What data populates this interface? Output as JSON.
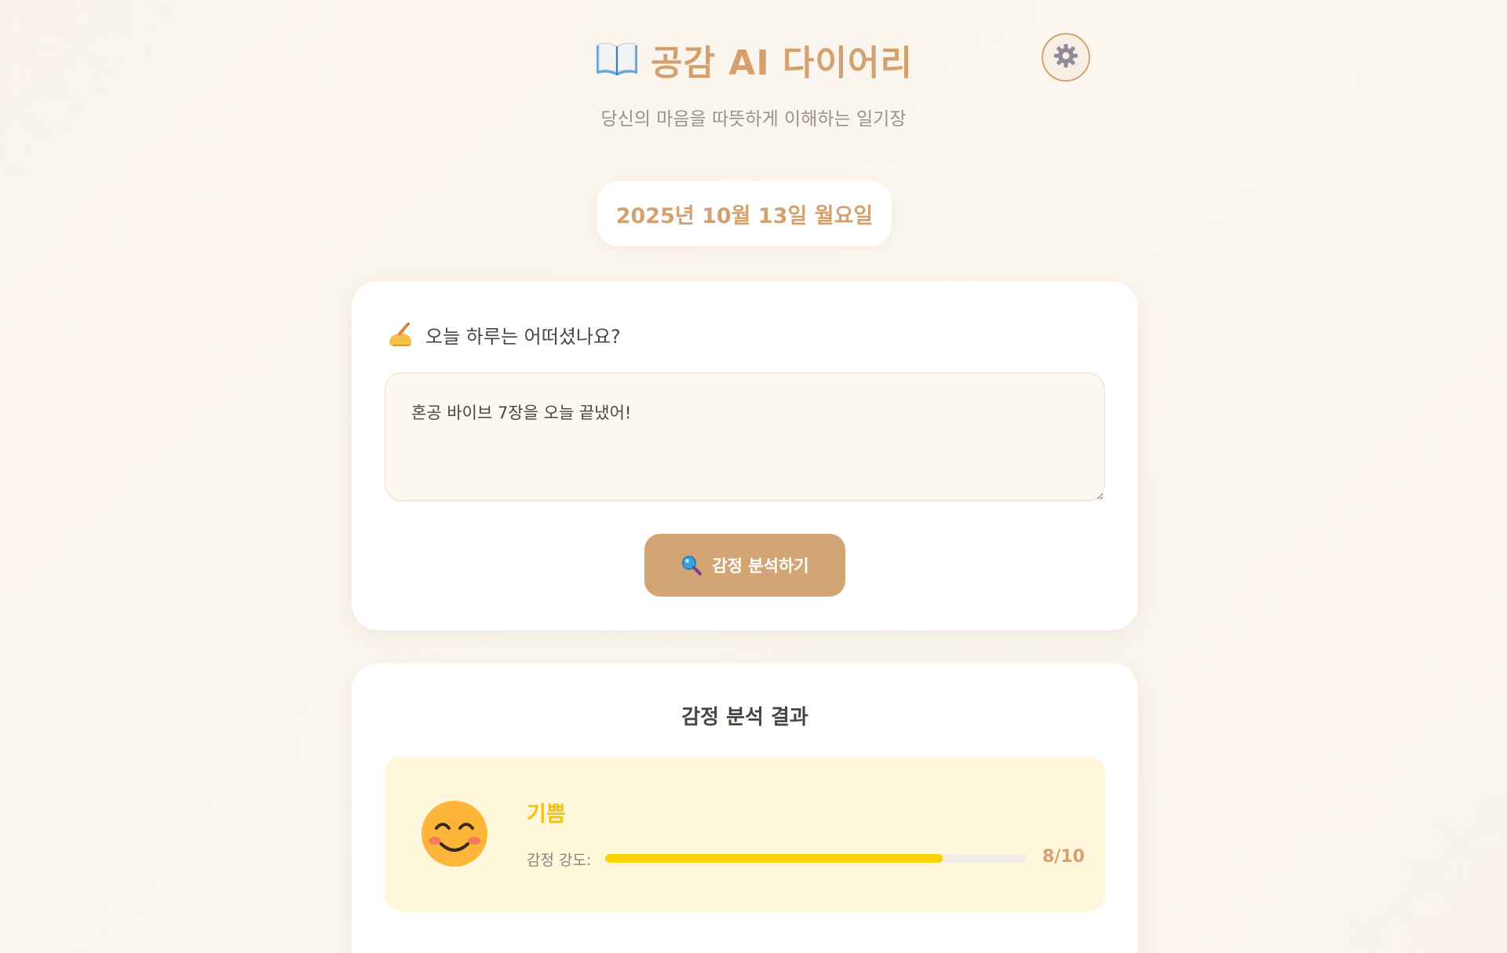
{
  "header": {
    "title": "공감 AI 다이어리",
    "subtitle": "당신의 마음을 따뜻하게 이해하는 일기장",
    "title_icon": "open-book-icon",
    "settings_icon": "gear-icon"
  },
  "date": {
    "label": "2025년 10월 13일 월요일"
  },
  "entry": {
    "prompt": "오늘 하루는 어떠셨나요?",
    "prompt_icon": "writing-hand-icon",
    "text": "혼공 바이브 7장을 오늘 끝냈어!",
    "analyze_button_label": "감정 분석하기",
    "analyze_button_icon": "magnifier-icon"
  },
  "result": {
    "title": "감정 분석 결과",
    "emotion_icon": "smiling-face-icon",
    "emotion_name": "기쁨",
    "intensity_label": "감정 강도:",
    "intensity_value": 8,
    "intensity_max": 10,
    "intensity_text": "8/10"
  },
  "colors": {
    "accent": "#d4a16e",
    "button": "#d4a574",
    "emotion_yellow": "#f4c20d",
    "bar_fill": "#fad300",
    "emotion_bg": "#fff7dc"
  }
}
